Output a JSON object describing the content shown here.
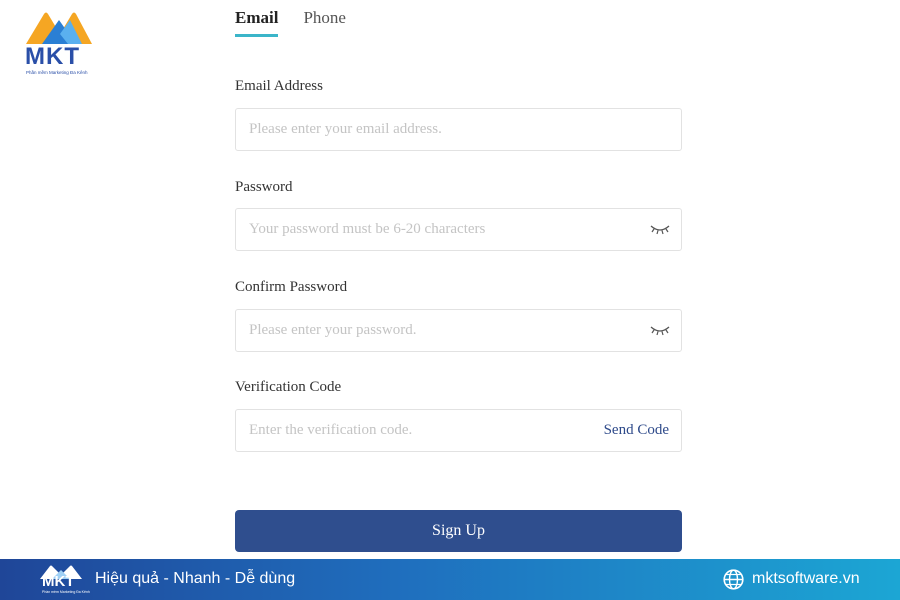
{
  "logo": {
    "brand": "MKT",
    "tagline": "Phần mềm Marketing Đa Kênh"
  },
  "tabs": [
    {
      "label": "Email",
      "active": true
    },
    {
      "label": "Phone",
      "active": false
    }
  ],
  "form": {
    "email": {
      "label": "Email Address",
      "placeholder": "Please enter your email address."
    },
    "password": {
      "label": "Password",
      "placeholder": "Your password must be 6-20 characters"
    },
    "confirm": {
      "label": "Confirm Password",
      "placeholder": "Please enter your password."
    },
    "code": {
      "label": "Verification Code",
      "placeholder": "Enter the verification code.",
      "send_label": "Send Code"
    },
    "submit_label": "Sign Up"
  },
  "footer": {
    "brand": "MKT",
    "tagline": "Phần mềm Marketing Đa Kênh",
    "slogan": "Hiệu quả - Nhanh - Dễ dùng",
    "website": "mktsoftware.vn"
  },
  "icons": {
    "password_toggle": "eye-closed-icon",
    "website": "globe-icon"
  },
  "colors": {
    "accent": "#3bb5c9",
    "primary": "#2f4e8e",
    "footer_start": "#1f4698",
    "footer_end": "#1ca6d4"
  }
}
